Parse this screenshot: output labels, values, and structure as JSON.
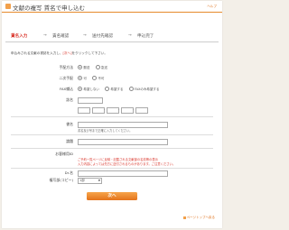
{
  "header": {
    "title": "文献の複写 賃名で申し込む",
    "help_label": "ヘルプ"
  },
  "steps": [
    {
      "label": "賃名入力",
      "active": true
    },
    {
      "label": "賃名確認",
      "active": false
    },
    {
      "label": "送付先確認",
      "active": false
    },
    {
      "label": "申込完了",
      "active": false
    }
  ],
  "intro": {
    "text_before": "申込みされる文献の書誌を入力し、",
    "highlight": "[次へ]",
    "text_after": "をクリックして下さい。"
  },
  "form": {
    "method": {
      "label": "手配方法",
      "options": [
        {
          "label": "郵送",
          "selected": true
        },
        {
          "label": "急送",
          "selected": false
        }
      ]
    },
    "color": {
      "label": "二次手配",
      "options": [
        {
          "label": "可",
          "selected": true
        },
        {
          "label": "不可",
          "selected": false
        }
      ]
    },
    "fax": {
      "label": "FAX織込",
      "options": [
        {
          "label": "希望しない",
          "selected": true
        },
        {
          "label": "希望する",
          "selected": false
        },
        {
          "label": "FAXのみ希望する",
          "selected": false
        }
      ]
    },
    "issn": {
      "label": "誌名",
      "value": "",
      "placeholder": ""
    },
    "vol_fields_note": "",
    "title_field": {
      "label": "書名",
      "value": "",
      "note": "書名及び号まで正確に入力してください。"
    },
    "author": {
      "label": "論題",
      "value": ""
    },
    "pages": {
      "label": "お客様用ID",
      "warning_line1": "ご予約一覧ページに反映・記載される文献部の名前等の表示",
      "warning_line2": "入力内容によっては先方に送付されるものがあります。ご注意ください。"
    },
    "cost": {
      "label": "Dr.名",
      "value": ""
    },
    "copy_count": {
      "label": "複写部(コピー)",
      "selected": "1部"
    }
  },
  "buttons": {
    "submit": "次へ"
  },
  "footer": {
    "back_label": "ページトップへ戻る"
  }
}
